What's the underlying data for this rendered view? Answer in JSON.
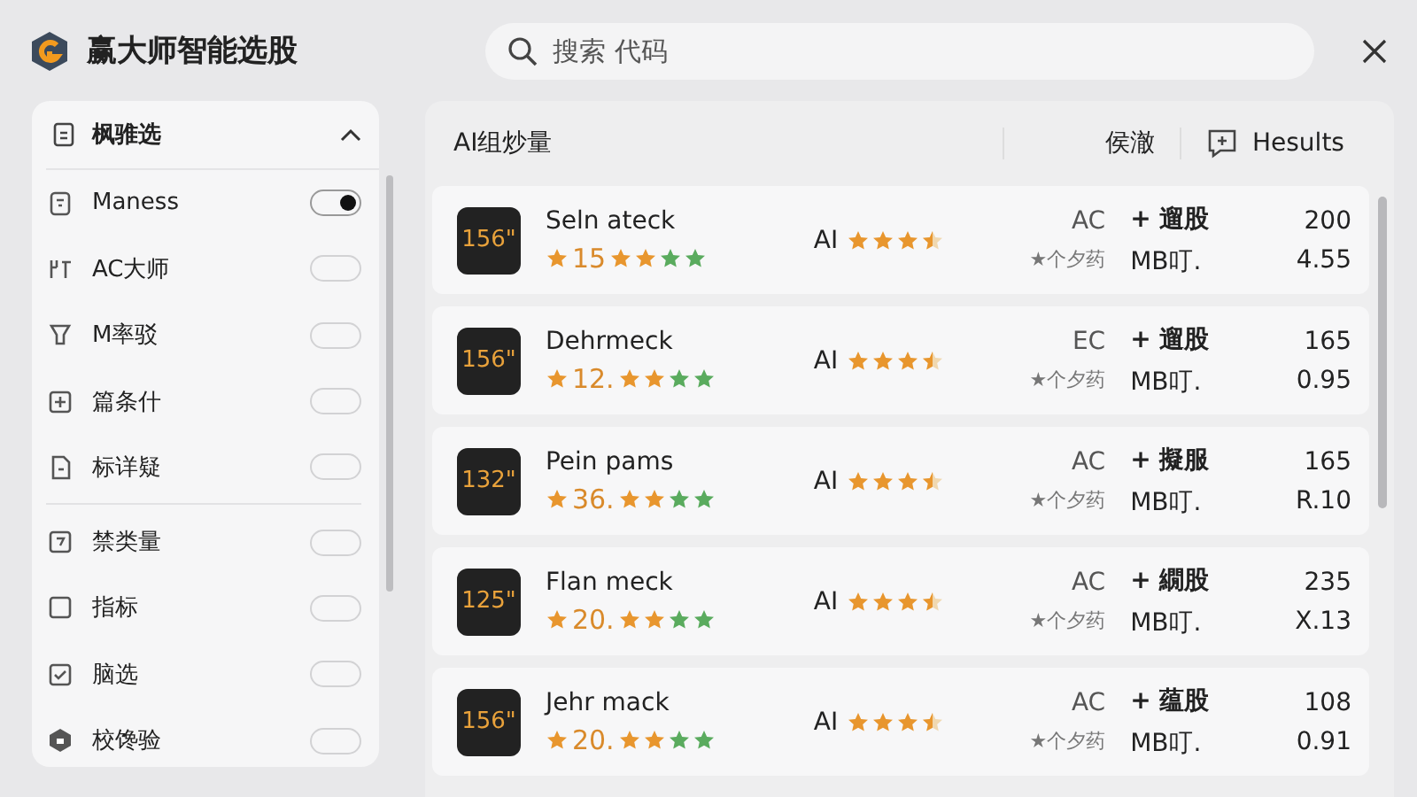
{
  "app": {
    "title": "赢大师智能选股"
  },
  "search": {
    "placeholder": "搜索 代码"
  },
  "sidebar": {
    "title": "枫骓选",
    "expanded": true,
    "items": [
      {
        "label": "Maness",
        "on": true
      },
      {
        "label": "AC大师",
        "on": false
      },
      {
        "label": "M率驳",
        "on": false
      },
      {
        "label": "篇条什",
        "on": false
      },
      {
        "label": "标详疑",
        "on": false
      },
      {
        "label": "禁类量",
        "on": false
      },
      {
        "label": "指标",
        "on": false
      },
      {
        "label": "脑选",
        "on": false
      },
      {
        "label": "校馋验",
        "on": false
      }
    ]
  },
  "table": {
    "columns": [
      "AI组炒量",
      "侯澈",
      "Hesults"
    ],
    "rows": [
      {
        "badge": "156\"",
        "name": "Seln ateck",
        "score": "15",
        "stars": 2,
        "ai": "AI",
        "ai_rating": {
          "stars": 3.5
        },
        "code": "AC",
        "note": "★个夕药",
        "action": "+ 遛股",
        "unit": "MB叮.",
        "value": "200",
        "change": "4.55"
      },
      {
        "badge": "156\"",
        "name": "Dehrmeck",
        "score": "12.",
        "stars": 2,
        "ai": "AI",
        "ai_rating": {
          "stars": 3.5
        },
        "code": "EC",
        "note": "★个夕药",
        "action": "+ 遛股",
        "unit": "MB叮.",
        "value": "165",
        "change": "0.95"
      },
      {
        "badge": "132\"",
        "name": "Pein pams",
        "score": "36.",
        "stars": 2,
        "ai": "AI",
        "ai_rating": {
          "stars": 3.5
        },
        "code": "AC",
        "note": "★个夕药",
        "action": "+ 擬服",
        "unit": "MB叮.",
        "value": "165",
        "change": "R.10"
      },
      {
        "badge": "125\"",
        "name": "Flan meck",
        "score": "20.",
        "stars": 2,
        "ai": "AI",
        "ai_rating": {
          "stars": 3.5
        },
        "code": "AC",
        "note": "★个夕药",
        "action": "+ 繝股",
        "unit": "MB叮.",
        "value": "235",
        "change": "X.13"
      },
      {
        "badge": "156\"",
        "name": "Jehr mack",
        "score": "20.",
        "stars": 2,
        "ai": "AI",
        "ai_rating": {
          "stars": 3.5
        },
        "code": "AC",
        "note": "★个夕药",
        "action": "+ 蕴股",
        "unit": "MB叮.",
        "value": "108",
        "change": "0.91"
      }
    ]
  }
}
